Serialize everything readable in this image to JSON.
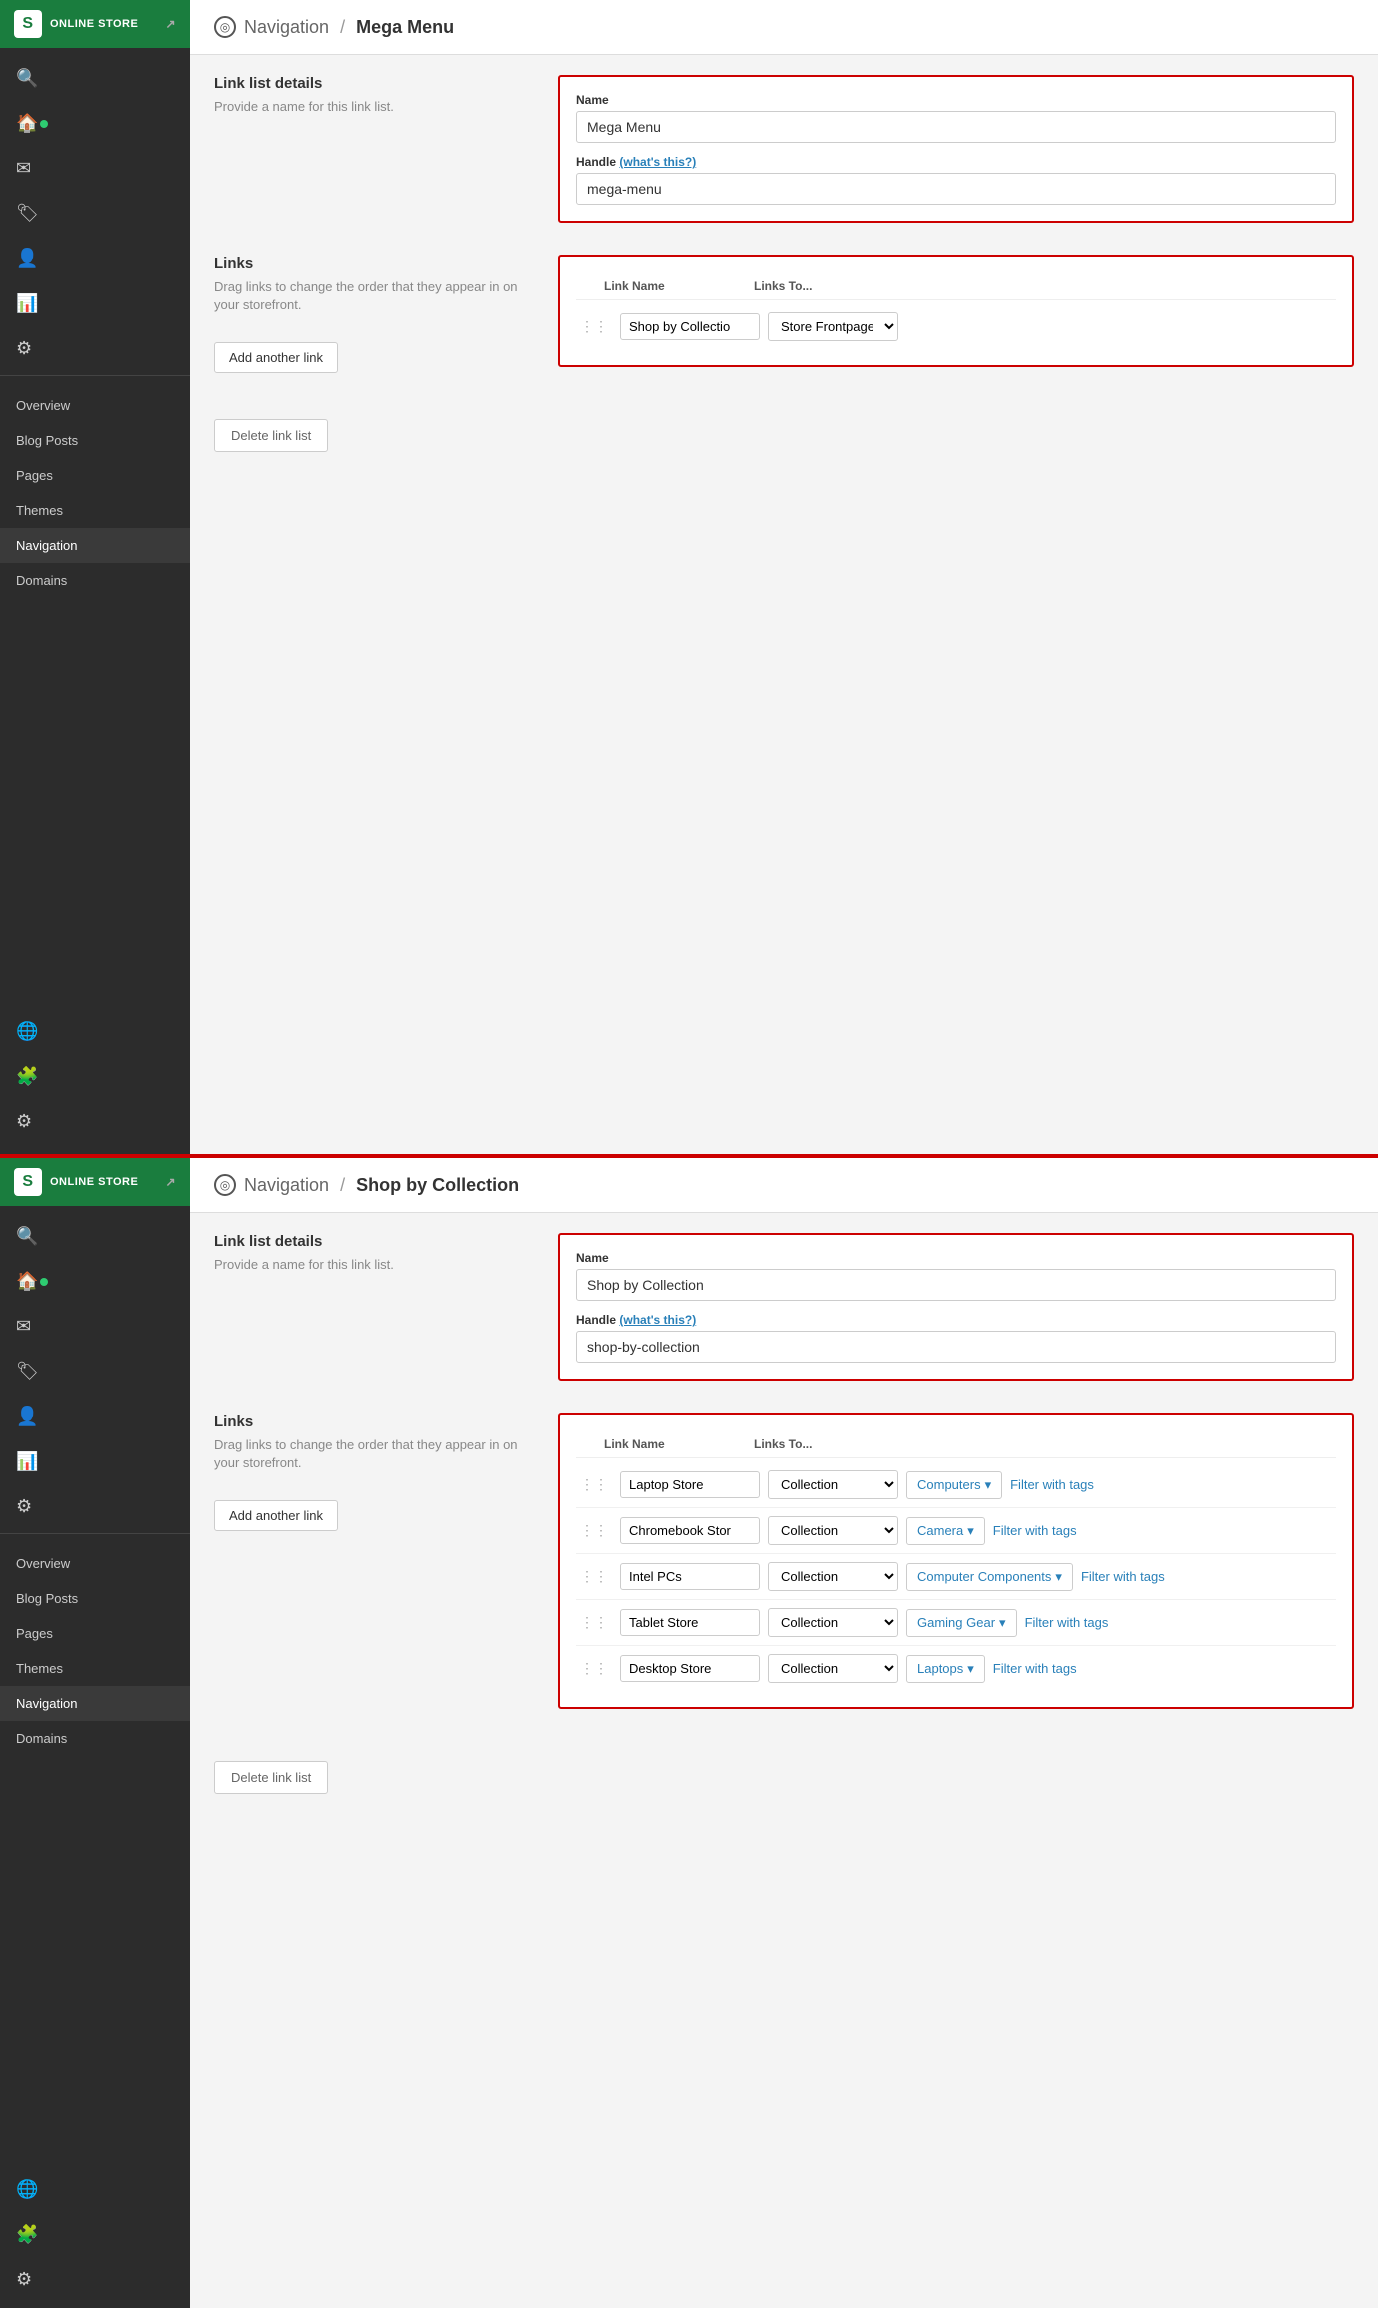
{
  "topPanel": {
    "sidebarHeader": "ONLINE STORE",
    "navItems": [
      {
        "label": "Overview",
        "active": false
      },
      {
        "label": "Blog Posts",
        "active": false
      },
      {
        "label": "Pages",
        "active": false
      },
      {
        "label": "Themes",
        "active": false
      },
      {
        "label": "Navigation",
        "active": true
      },
      {
        "label": "Domains",
        "active": false
      }
    ],
    "breadcrumb": {
      "section": "Navigation",
      "separator": "/",
      "title": "Mega Menu"
    },
    "linkListDetails": {
      "heading": "Link list details",
      "description": "Provide a name for this link list.",
      "nameLabel": "Name",
      "nameValue": "Mega Menu",
      "handleLabel": "Handle",
      "handleLinkText": "(what's this?)",
      "handleValue": "mega-menu"
    },
    "links": {
      "heading": "Links",
      "description": "Drag links to change the order that they appear in on your storefront.",
      "colName": "Link Name",
      "colLinks": "Links To...",
      "rows": [
        {
          "name": "Shop by Collectio",
          "linksTo": "Store Frontpage"
        }
      ],
      "addButton": "Add another link"
    },
    "deleteButton": "Delete link list"
  },
  "bottomPanel": {
    "sidebarHeader": "ONLINE STORE",
    "navItems": [
      {
        "label": "Overview",
        "active": false
      },
      {
        "label": "Blog Posts",
        "active": false
      },
      {
        "label": "Pages",
        "active": false
      },
      {
        "label": "Themes",
        "active": false
      },
      {
        "label": "Navigation",
        "active": true
      },
      {
        "label": "Domains",
        "active": false
      }
    ],
    "breadcrumb": {
      "section": "Navigation",
      "separator": "/",
      "title": "Shop by Collection"
    },
    "linkListDetails": {
      "heading": "Link list details",
      "description": "Provide a name for this link list.",
      "nameLabel": "Name",
      "nameValue": "Shop by Collection",
      "handleLabel": "Handle",
      "handleLinkText": "(what's this?)",
      "handleValue": "shop-by-collection"
    },
    "links": {
      "heading": "Links",
      "description": "Drag links to change the order that they appear in on your storefront.",
      "colName": "Link Name",
      "colLinks": "Links To...",
      "addButton": "Add another link",
      "rows": [
        {
          "name": "Laptop Store",
          "linksTo": "Collection",
          "collection": "Computers",
          "filterText": "Filter with tags"
        },
        {
          "name": "Chromebook Stor",
          "linksTo": "Collection",
          "collection": "Camera",
          "filterText": "Filter with tags"
        },
        {
          "name": "Intel PCs",
          "linksTo": "Collection",
          "collection": "Computer Components",
          "filterText": "Filter with tags"
        },
        {
          "name": "Tablet Store",
          "linksTo": "Collection",
          "collection": "Gaming Gear",
          "filterText": "Filter with tags"
        },
        {
          "name": "Desktop Store",
          "linksTo": "Collection",
          "collection": "Laptops",
          "filterText": "Filter with tags"
        }
      ]
    },
    "deleteButton": "Delete link list"
  },
  "icons": {
    "shopify": "S",
    "compass": "◎",
    "drag": "⋮⋮",
    "chevronDown": "▾",
    "externalLink": "↗"
  }
}
